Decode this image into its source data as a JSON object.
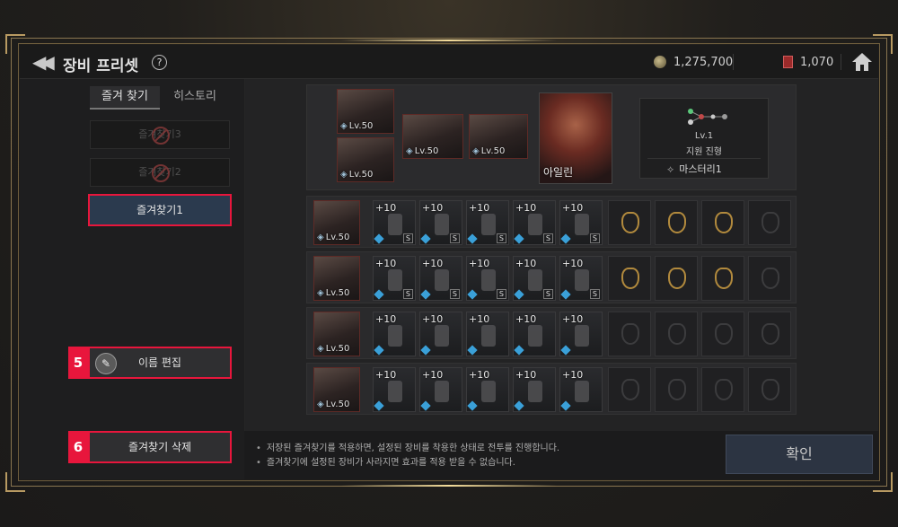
{
  "header": {
    "title": "장비 프리셋",
    "help_glyph": "?",
    "gold_amount": "1,275,700",
    "ticket_amount": "1,070"
  },
  "tabs": [
    {
      "label": "즐겨 찾기",
      "active": true
    },
    {
      "label": "히스토리",
      "active": false
    }
  ],
  "favorites": {
    "slot3_label": "즐겨찾기3",
    "slot2_label": "즐겨찾기2",
    "slot1_label": "즐겨찾기1"
  },
  "actions": {
    "rename_label": "이름 편집",
    "rename_badge": "5",
    "delete_label": "즐겨찾기 삭제",
    "delete_badge": "6"
  },
  "party": {
    "level_tag": "Lv.50",
    "leader_name": "아일린",
    "formation": {
      "level": "Lv.1",
      "name": "지원 진형",
      "mastery": "마스터리1"
    }
  },
  "equipment_rows": [
    {
      "level": "Lv.50",
      "items": [
        "+10",
        "+10",
        "+10",
        "+10",
        "+10"
      ],
      "accessories_equipped": true
    },
    {
      "level": "Lv.50",
      "items": [
        "+10",
        "+10",
        "+10",
        "+10",
        "+10"
      ],
      "accessories_equipped": true
    },
    {
      "level": "Lv.50",
      "items": [
        "+10",
        "+10",
        "+10",
        "+10",
        "+10"
      ],
      "accessories_equipped": false
    },
    {
      "level": "Lv.50",
      "items": [
        "+10",
        "+10",
        "+10",
        "+10",
        "+10"
      ],
      "accessories_equipped": false
    }
  ],
  "footer": {
    "notice_1": "저장된 즐겨찾기를 적용하면, 설정된 장비를 착용한 상태로 전투를 진행합니다.",
    "notice_2": "즐겨찾기에 설정된 장비가 사라지면 효과를 적용 받을 수 없습니다.",
    "confirm_label": "확인"
  },
  "colors": {
    "highlight": "#e8163c",
    "frame_gold": "#b89a62",
    "confirm_bg": "#2c3442"
  },
  "icons": [
    "back-icon",
    "help-icon",
    "coin-icon",
    "ticket-icon",
    "home-icon",
    "no-entry-icon",
    "feather-icon",
    "formation-icon",
    "mastery-icon"
  ]
}
